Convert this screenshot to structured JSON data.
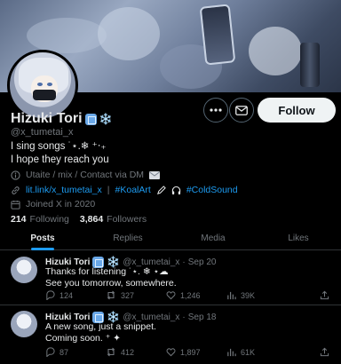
{
  "profile": {
    "name": "Hizuki Tori",
    "name_emoji": "❄️",
    "handle": "@x_tumetai_x",
    "bio_lines": [
      "I sing songs ˙⋆.❄︎ ⁺‧₊",
      "I hope they reach you"
    ],
    "category": "Utaite / mix / Contact via DM",
    "link": "lit.link/x_tumetai_x",
    "hashtags": [
      "#KoalArt",
      "#ColdSound"
    ],
    "joined": "Joined X in 2020",
    "following_count": "214",
    "following_label": "Following",
    "followers_count": "3,864",
    "followers_label": "Followers",
    "follow_button": "Follow"
  },
  "tabs": [
    {
      "label": "Posts",
      "active": true
    },
    {
      "label": "Replies",
      "active": false
    },
    {
      "label": "Media",
      "active": false
    },
    {
      "label": "Likes",
      "active": false
    }
  ],
  "tweets": [
    {
      "name": "Hizuki Tori",
      "handle": "@x_tumetai_x",
      "date": "Sep 20",
      "lines": [
        "Thanks for listening ˙⋆. ❄︎ ⋆☁︎",
        "See you tomorrow, somewhere."
      ],
      "replies": "124",
      "reposts": "327",
      "likes": "1,246",
      "views": "39K"
    },
    {
      "name": "Hizuki Tori",
      "handle": "@x_tumetai_x",
      "date": "Sep 18",
      "lines": [
        "A new song, just a snippet.",
        "Coming soon. ⁺ ✦"
      ],
      "replies": "87",
      "reposts": "412",
      "likes": "1,897",
      "views": "61K"
    }
  ],
  "colors": {
    "accent": "#1d9bf0",
    "background": "#000000",
    "muted_text": "#71767b",
    "divider": "#2f3336"
  }
}
